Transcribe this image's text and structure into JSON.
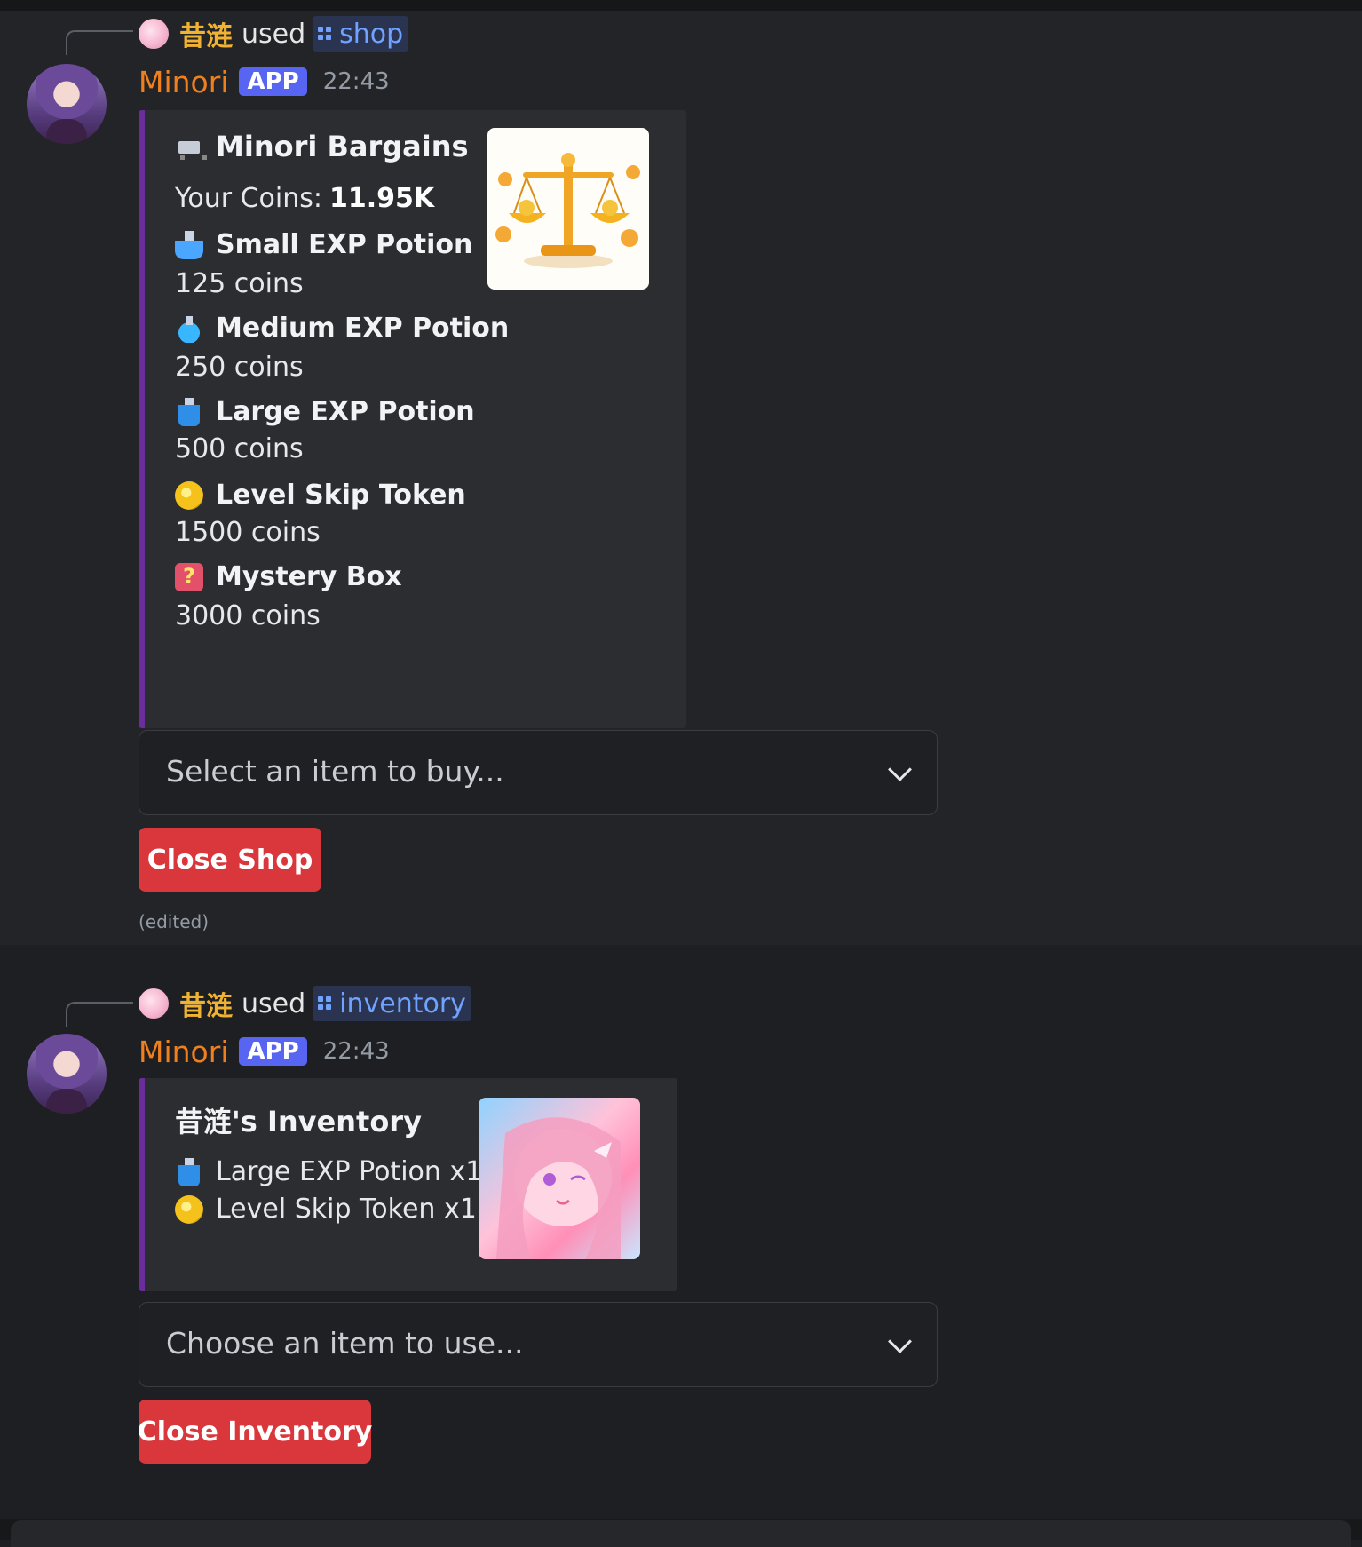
{
  "messages": [
    {
      "invoker": {
        "name": "昔涟",
        "used_label": "used",
        "command": "shop"
      },
      "author": "Minori",
      "app_tag": "APP",
      "time": "22:43",
      "embed": {
        "title": "Minori Bargains",
        "coins_label": "Your Coins:",
        "coins_value": "11.95K",
        "items": [
          {
            "icon": "small-potion-icon",
            "name": "Small EXP Potion",
            "price": "125 coins"
          },
          {
            "icon": "medium-potion-icon",
            "name": "Medium EXP Potion",
            "price": "250 coins"
          },
          {
            "icon": "large-potion-icon",
            "name": "Large EXP Potion",
            "price": "500 coins"
          },
          {
            "icon": "coin-icon",
            "name": "Level Skip Token",
            "price": "1500 coins"
          },
          {
            "icon": "mystery-box-icon",
            "name": "Mystery Box",
            "price": "3000 coins"
          }
        ]
      },
      "select_placeholder": "Select an item to buy...",
      "button_label": "Close Shop",
      "edited_label": "(edited)"
    },
    {
      "invoker": {
        "name": "昔涟",
        "used_label": "used",
        "command": "inventory"
      },
      "author": "Minori",
      "app_tag": "APP",
      "time": "22:43",
      "embed": {
        "title": "昔涟's Inventory",
        "items": [
          {
            "icon": "large-potion-icon",
            "text": "Large EXP Potion x1"
          },
          {
            "icon": "coin-icon",
            "text": "Level Skip Token x1"
          }
        ]
      },
      "select_placeholder": "Choose an item to use...",
      "button_label": "Close Inventory"
    }
  ],
  "colors": {
    "embed_border": "#6c2d9c",
    "author": "#f0801e",
    "invoker": "#f0b232",
    "danger_button": "#da373c",
    "app_tag": "#5865f2",
    "command_link": "#6fa3ff"
  }
}
